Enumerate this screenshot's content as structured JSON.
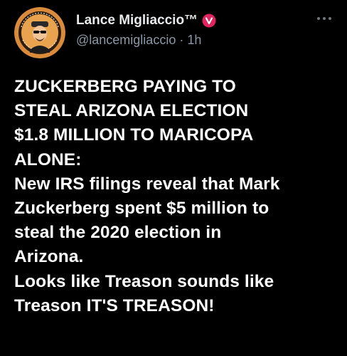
{
  "tweet": {
    "author": {
      "display_name": "Lance Migliaccio™",
      "handle": "@lancemigliaccio",
      "separator": "·",
      "time": "1h",
      "verified_icon": "verified-badge-icon",
      "avatar_icon": "avatar-logo-icon"
    },
    "more_icon": "more-dots-icon",
    "lines": [
      "ZUCKERBERG PAYING TO",
      "STEAL ARIZONA ELECTION",
      "$1.8 MILLION TO MARICOPA",
      "ALONE:",
      "New IRS filings reveal that Mark",
      "Zuckerberg spent $5 million to",
      "steal the 2020 election in",
      "Arizona.",
      "Looks like Treason sounds like",
      "Treason IT'S TREASON!"
    ]
  },
  "colors": {
    "background": "#000000",
    "text_primary": "#ffffff",
    "text_secondary": "#8b98a5",
    "verified_badge": "#e0245e"
  }
}
